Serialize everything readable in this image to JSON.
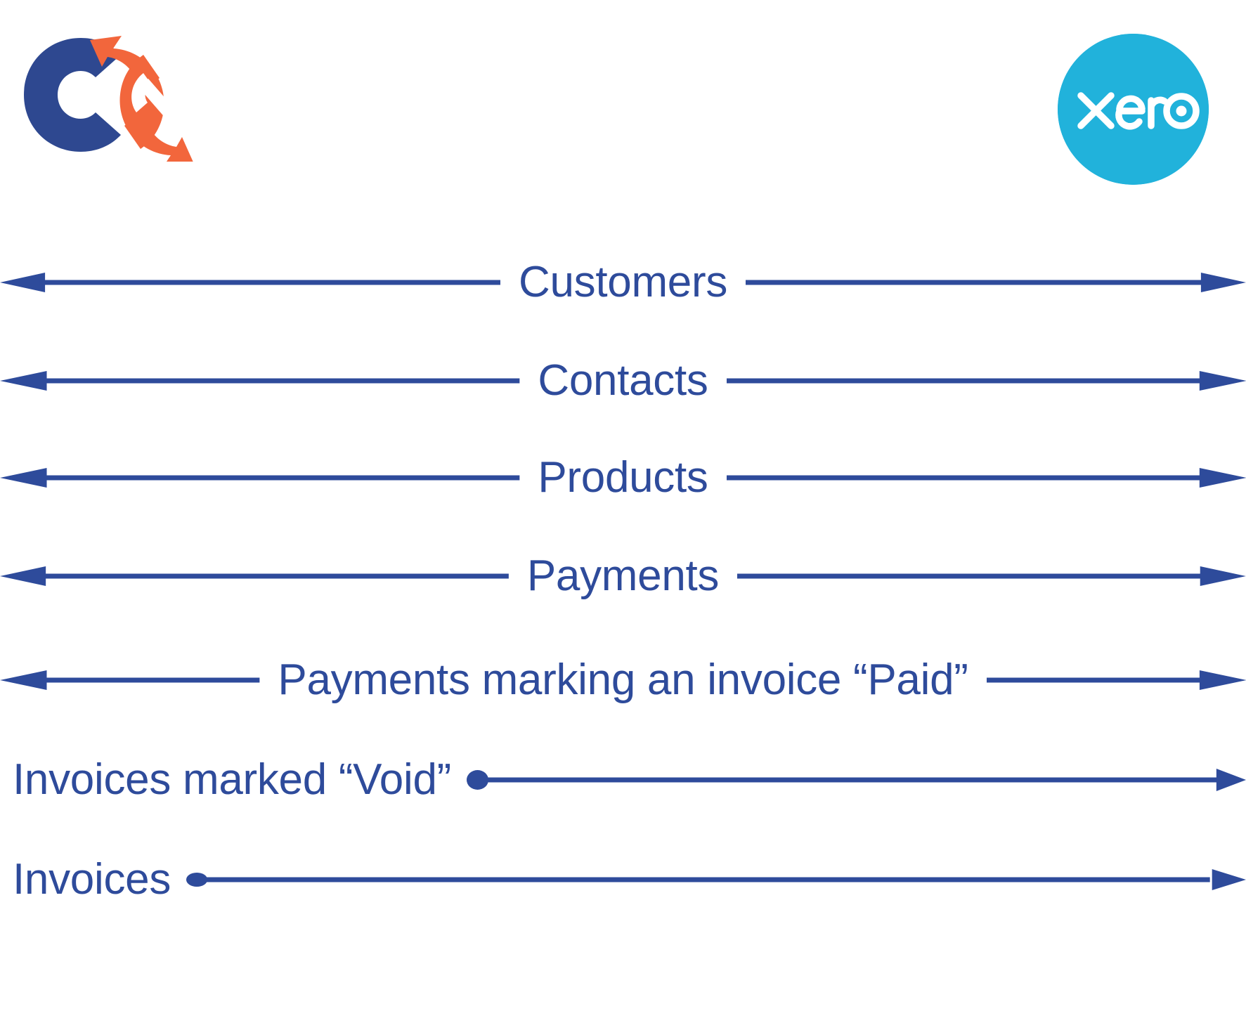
{
  "page": {
    "background": "#ffffff",
    "accent_blue": "#2E4B9B",
    "accent_orange": "#F2663C",
    "xero_cyan": "#21B2DB"
  },
  "logos": {
    "left": {
      "name": "commercient-sync-logo",
      "alt_text": "C with circular sync arrows",
      "letter_color": "#2E4890",
      "arrows_color": "#F2663C"
    },
    "right": {
      "name": "xero-logo",
      "wordmark": "xero",
      "circle_color": "#21B2DB",
      "wordmark_color": "#ffffff"
    }
  },
  "flows": [
    {
      "label": "Customers",
      "direction": "bidirectional",
      "left_end": "arrow",
      "right_end": "arrow",
      "label_align": "center"
    },
    {
      "label": "Contacts",
      "direction": "bidirectional",
      "left_end": "arrow",
      "right_end": "arrow",
      "label_align": "center"
    },
    {
      "label": "Products",
      "direction": "bidirectional",
      "left_end": "arrow",
      "right_end": "arrow",
      "label_align": "center"
    },
    {
      "label": "Payments",
      "direction": "bidirectional",
      "left_end": "arrow",
      "right_end": "arrow",
      "label_align": "center"
    },
    {
      "label": "Payments marking an invoice “Paid”",
      "direction": "bidirectional",
      "left_end": "arrow",
      "right_end": "arrow",
      "label_align": "center"
    },
    {
      "label": "Invoices marked “Void”",
      "direction": "left-to-right",
      "left_end": "dot",
      "right_end": "arrow",
      "label_align": "left"
    },
    {
      "label": "Invoices",
      "direction": "left-to-right",
      "left_end": "dot",
      "right_end": "arrow",
      "label_align": "left"
    }
  ]
}
